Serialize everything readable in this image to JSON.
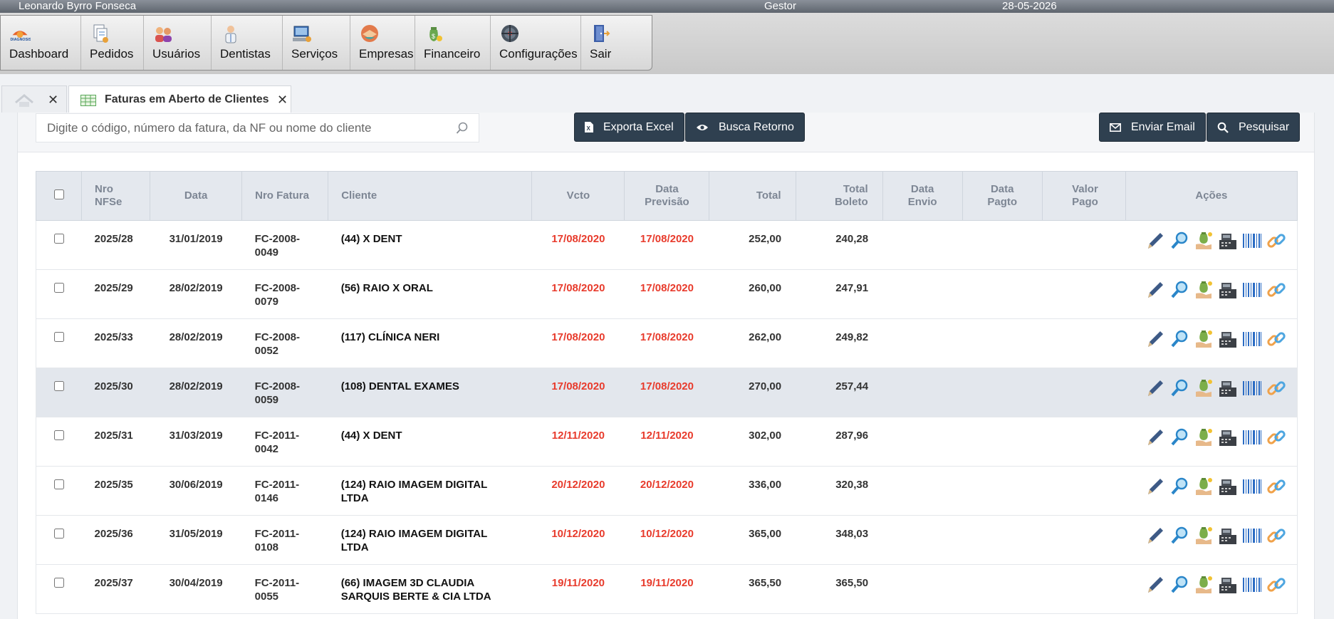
{
  "topbar": {
    "user": "Leonardo Byrro Fonseca",
    "role": "Gestor",
    "date": "28-05-2026"
  },
  "menu": [
    {
      "label": "Dashboard",
      "icon": "diagnosis-logo-icon"
    },
    {
      "label": "Pedidos",
      "icon": "documents-icon"
    },
    {
      "label": "Usuários",
      "icon": "users-icon"
    },
    {
      "label": "Dentistas",
      "icon": "dentist-icon"
    },
    {
      "label": "Serviços",
      "icon": "computer-icon"
    },
    {
      "label": "Empresas",
      "icon": "handshake-icon"
    },
    {
      "label": "Financeiro",
      "icon": "money-bag-icon"
    },
    {
      "label": "Configurações",
      "icon": "settings-wheel-icon"
    },
    {
      "label": "Sair",
      "icon": "exit-door-icon"
    }
  ],
  "tabs": {
    "active_label": "Faturas em Aberto de Clientes"
  },
  "search": {
    "placeholder": "Digite o código, número da fatura, da NF ou nome do cliente"
  },
  "toolbar": {
    "export_label": "Exporta Excel",
    "retorno_label": "Busca Retorno",
    "email_label": "Enviar Email",
    "search_label": "Pesquisar"
  },
  "table": {
    "headers": {
      "nfse": [
        "Nro",
        "NFSe"
      ],
      "data": "Data",
      "fatura": "Nro Fatura",
      "cliente": "Cliente",
      "vcto": "Vcto",
      "previsao": [
        "Data",
        "Previsão"
      ],
      "total": "Total",
      "boleto": [
        "Total",
        "Boleto"
      ],
      "envio": [
        "Data",
        "Envio"
      ],
      "pagto": [
        "Data",
        "Pagto"
      ],
      "valor": [
        "Valor",
        "Pago"
      ],
      "acoes": "Ações"
    },
    "rows": [
      {
        "nfse": "2025/28",
        "data": "31/01/2019",
        "fatura": [
          "FC-2008-",
          "0049"
        ],
        "cliente": [
          "(44) X DENT",
          ""
        ],
        "vcto": "17/08/2020",
        "previsao": "17/08/2020",
        "total": "252,00",
        "boleto": "240,28",
        "envio": "",
        "pagto": "",
        "valor": ""
      },
      {
        "nfse": "2025/29",
        "data": "28/02/2019",
        "fatura": [
          "FC-2008-",
          "0079"
        ],
        "cliente": [
          "(56) RAIO X ORAL",
          ""
        ],
        "vcto": "17/08/2020",
        "previsao": "17/08/2020",
        "total": "260,00",
        "boleto": "247,91",
        "envio": "",
        "pagto": "",
        "valor": ""
      },
      {
        "nfse": "2025/33",
        "data": "28/02/2019",
        "fatura": [
          "FC-2008-",
          "0052"
        ],
        "cliente": [
          "(117) CLÍNICA NERI",
          ""
        ],
        "vcto": "17/08/2020",
        "previsao": "17/08/2020",
        "total": "262,00",
        "boleto": "249,82",
        "envio": "",
        "pagto": "",
        "valor": ""
      },
      {
        "nfse": "2025/30",
        "data": "28/02/2019",
        "fatura": [
          "FC-2008-",
          "0059"
        ],
        "cliente": [
          "(108) DENTAL EXAMES",
          ""
        ],
        "vcto": "17/08/2020",
        "previsao": "17/08/2020",
        "total": "270,00",
        "boleto": "257,44",
        "envio": "",
        "pagto": "",
        "valor": ""
      },
      {
        "nfse": "2025/31",
        "data": "31/03/2019",
        "fatura": [
          "FC-2011-",
          "0042"
        ],
        "cliente": [
          "(44) X DENT",
          ""
        ],
        "vcto": "12/11/2020",
        "previsao": "12/11/2020",
        "total": "302,00",
        "boleto": "287,96",
        "envio": "",
        "pagto": "",
        "valor": ""
      },
      {
        "nfse": "2025/35",
        "data": "30/06/2019",
        "fatura": [
          "FC-2011-",
          "0146"
        ],
        "cliente": [
          "(124) RAIO IMAGEM DIGITAL",
          "LTDA"
        ],
        "vcto": "20/12/2020",
        "previsao": "20/12/2020",
        "total": "336,00",
        "boleto": "320,38",
        "envio": "",
        "pagto": "",
        "valor": ""
      },
      {
        "nfse": "2025/36",
        "data": "31/05/2019",
        "fatura": [
          "FC-2011-",
          "0108"
        ],
        "cliente": [
          "(124) RAIO IMAGEM DIGITAL",
          "LTDA"
        ],
        "vcto": "10/12/2020",
        "previsao": "10/12/2020",
        "total": "365,00",
        "boleto": "348,03",
        "envio": "",
        "pagto": "",
        "valor": ""
      },
      {
        "nfse": "2025/37",
        "data": "30/04/2019",
        "fatura": [
          "FC-2011-",
          "0055"
        ],
        "cliente": [
          "(66) IMAGEM 3D CLAUDIA",
          "SARQUIS BERTE & CIA LTDA"
        ],
        "vcto": "19/11/2020",
        "previsao": "19/11/2020",
        "total": "365,50",
        "boleto": "365,50",
        "envio": "",
        "pagto": "",
        "valor": ""
      }
    ],
    "highlight_row": 3,
    "row_actions": [
      "pencil-icon",
      "magnifier-icon",
      "money-bag-icon",
      "cash-register-icon",
      "barcode-icon",
      "link-icon"
    ]
  },
  "colors": {
    "date_red": "#e83b2c",
    "button_dark": "#2f4050",
    "header_bg": "#e4e8ee"
  }
}
